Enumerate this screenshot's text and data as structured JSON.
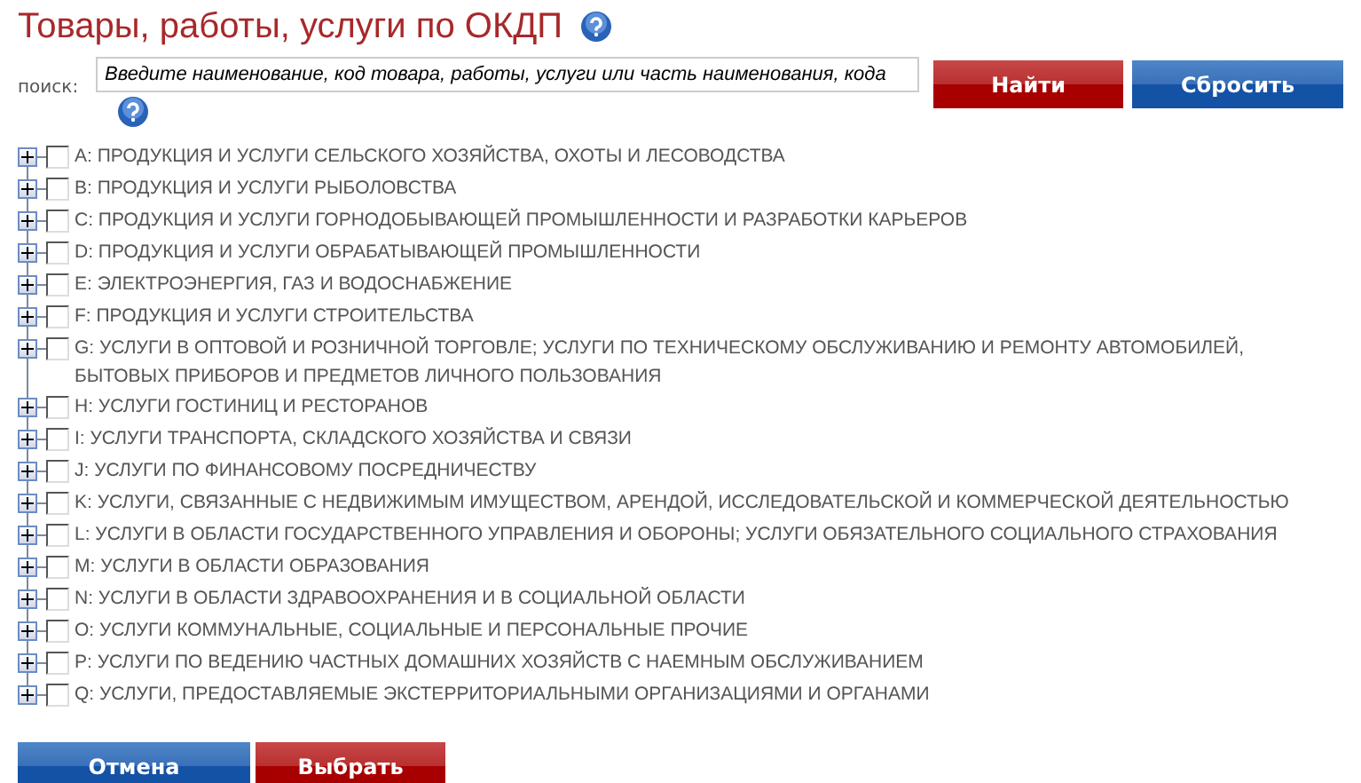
{
  "title": "Товары, работы, услуги по ОКДП",
  "search": {
    "label": "поиск:",
    "placeholder": "Введите наименование, код товара, работы, услуги или часть наименования, кода"
  },
  "search_buttons": [
    {
      "label": "Найти",
      "kind": "primary"
    },
    {
      "label": "Сбросить",
      "kind": "secondary"
    }
  ],
  "tree": [
    {
      "label": "A: ПРОДУКЦИЯ И УСЛУГИ СЕЛЬСКОГО ХОЗЯЙСТВА, ОХОТЫ И ЛЕСОВОДСТВА",
      "checked": false,
      "expanded": false
    },
    {
      "label": "B: ПРОДУКЦИЯ И УСЛУГИ РЫБОЛОВСТВА",
      "checked": false,
      "expanded": false
    },
    {
      "label": "C: ПРОДУКЦИЯ И УСЛУГИ ГОРНОДОБЫВАЮЩЕЙ ПРОМЫШЛЕННОСТИ И РАЗРАБОТКИ КАРЬЕРОВ",
      "checked": false,
      "expanded": false
    },
    {
      "label": "D: ПРОДУКЦИЯ И УСЛУГИ ОБРАБАТЫВАЮЩЕЙ ПРОМЫШЛЕННОСТИ",
      "checked": false,
      "expanded": false
    },
    {
      "label": "E: ЭЛЕКТРОЭНЕРГИЯ, ГАЗ И ВОДОСНАБЖЕНИЕ",
      "checked": false,
      "expanded": false
    },
    {
      "label": "F: ПРОДУКЦИЯ И УСЛУГИ СТРОИТЕЛЬСТВА",
      "checked": false,
      "expanded": false
    },
    {
      "label": "G: УСЛУГИ В ОПТОВОЙ И РОЗНИЧНОЙ ТОРГОВЛЕ; УСЛУГИ ПО ТЕХНИЧЕСКОМУ ОБСЛУЖИВАНИЮ И РЕМОНТУ АВТОМОБИЛЕЙ, БЫТОВЫХ ПРИБОРОВ И ПРЕДМЕТОВ ЛИЧНОГО ПОЛЬЗОВАНИЯ",
      "checked": false,
      "expanded": false
    },
    {
      "label": "H: УСЛУГИ ГОСТИНИЦ И РЕСТОРАНОВ",
      "checked": false,
      "expanded": false
    },
    {
      "label": "I: УСЛУГИ ТРАНСПОРТА, СКЛАДСКОГО ХОЗЯЙСТВА И СВЯЗИ",
      "checked": false,
      "expanded": false
    },
    {
      "label": "J: УСЛУГИ ПО ФИНАНСОВОМУ ПОСРЕДНИЧЕСТВУ",
      "checked": false,
      "expanded": false
    },
    {
      "label": "K: УСЛУГИ, СВЯЗАННЫЕ С НЕДВИЖИМЫМ ИМУЩЕСТВОМ, АРЕНДОЙ, ИССЛЕДОВАТЕЛЬСКОЙ И КОММЕРЧЕСКОЙ ДЕЯТЕЛЬНОСТЬЮ",
      "checked": false,
      "expanded": false
    },
    {
      "label": "L: УСЛУГИ В ОБЛАСТИ ГОСУДАРСТВЕННОГО УПРАВЛЕНИЯ И ОБОРОНЫ; УСЛУГИ ОБЯЗАТЕЛЬНОГО СОЦИАЛЬНОГО СТРАХОВАНИЯ",
      "checked": false,
      "expanded": false
    },
    {
      "label": "M: УСЛУГИ В ОБЛАСТИ ОБРАЗОВАНИЯ",
      "checked": false,
      "expanded": false
    },
    {
      "label": "N: УСЛУГИ В ОБЛАСТИ ЗДРАВООХРАНЕНИЯ И В СОЦИАЛЬНОЙ ОБЛАСТИ",
      "checked": false,
      "expanded": false
    },
    {
      "label": "O: УСЛУГИ КОММУНАЛЬНЫЕ, СОЦИАЛЬНЫЕ И ПЕРСОНАЛЬНЫЕ ПРОЧИЕ",
      "checked": false,
      "expanded": false
    },
    {
      "label": "P: УСЛУГИ ПО ВЕДЕНИЮ ЧАСТНЫХ ДОМАШНИХ ХОЗЯЙСТВ С НАЕМНЫМ ОБСЛУЖИВАНИЕМ",
      "checked": false,
      "expanded": false
    },
    {
      "label": "Q: УСЛУГИ, ПРЕДОСТАВЛЯЕМЫЕ ЭКСТЕРРИТОРИАЛЬНЫМИ ОРГАНИЗАЦИЯМИ И ОРГАНАМИ",
      "checked": false,
      "expanded": false
    }
  ],
  "footer_buttons": [
    {
      "label": "Отмена",
      "kind": "secondary"
    },
    {
      "label": "Выбрать",
      "kind": "primary"
    }
  ]
}
